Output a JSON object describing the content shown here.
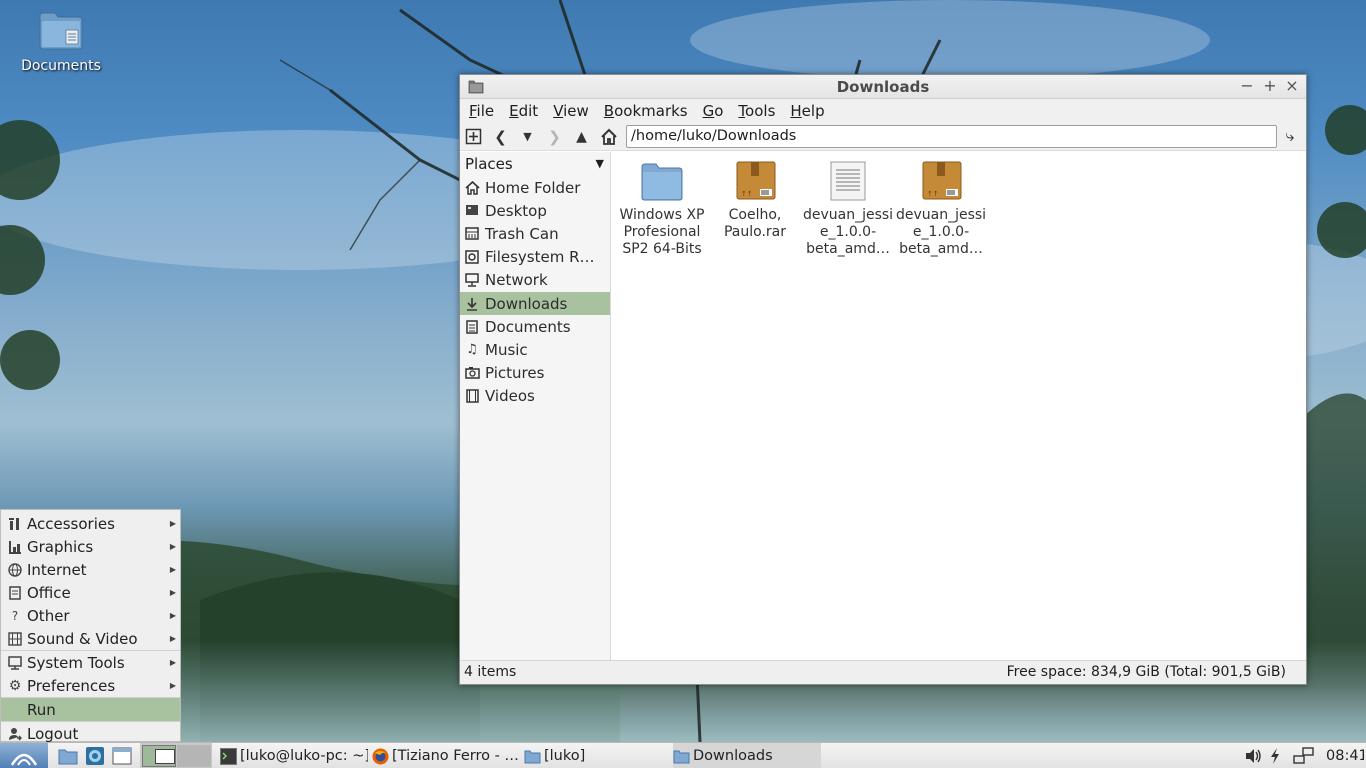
{
  "desktop": {
    "icons": [
      {
        "label": "Documents",
        "icon": "folder-icon"
      }
    ]
  },
  "window": {
    "title": "Downloads",
    "controls": {
      "minimize": "−",
      "maximize": "+",
      "close": "×"
    },
    "menu": [
      {
        "label": "File",
        "u": "F",
        "rest": "ile"
      },
      {
        "label": "Edit",
        "u": "E",
        "rest": "dit"
      },
      {
        "label": "View",
        "u": "V",
        "rest": "iew"
      },
      {
        "label": "Bookmarks",
        "u": "B",
        "rest": "ookmarks"
      },
      {
        "label": "Go",
        "u": "G",
        "rest": "o"
      },
      {
        "label": "Tools",
        "u": "T",
        "rest": "ools"
      },
      {
        "label": "Help",
        "u": "H",
        "rest": "elp"
      }
    ],
    "path": "/home/luko/Downloads",
    "sidebar": {
      "header": "Places",
      "items": [
        {
          "label": "Home Folder",
          "icon": "home-icon"
        },
        {
          "label": "Desktop",
          "icon": "desktop-icon"
        },
        {
          "label": "Trash Can",
          "icon": "trash-icon"
        },
        {
          "label": "Filesystem R…",
          "icon": "drive-icon"
        },
        {
          "label": "Network",
          "icon": "network-icon"
        },
        {
          "label": "Downloads",
          "icon": "download-icon",
          "active": true
        },
        {
          "label": "Documents",
          "icon": "document-icon"
        },
        {
          "label": "Music",
          "icon": "music-icon"
        },
        {
          "label": "Pictures",
          "icon": "camera-icon"
        },
        {
          "label": "Videos",
          "icon": "film-icon"
        }
      ]
    },
    "files": [
      {
        "line1": "Windows XP",
        "line2": "Profesional",
        "line3": "SP2 64-Bits",
        "icon": "folder-icon"
      },
      {
        "line1": "Coelho,",
        "line2": "Paulo.rar",
        "line3": "",
        "icon": "archive-icon"
      },
      {
        "line1": "devuan_jessi",
        "line2": "e_1.0.0-",
        "line3": "beta_amd…",
        "icon": "text-file-icon"
      },
      {
        "line1": "devuan_jessi",
        "line2": "e_1.0.0-",
        "line3": "beta_amd…",
        "icon": "archive-icon"
      }
    ],
    "status": {
      "items": "4 items",
      "space": "Free space: 834,9 GiB (Total: 901,5 GiB)"
    }
  },
  "start_menu": {
    "items": [
      {
        "label": "Accessories",
        "icon": "accessories-icon",
        "submenu": true
      },
      {
        "label": "Graphics",
        "icon": "graphics-icon",
        "submenu": true
      },
      {
        "label": "Internet",
        "icon": "globe-icon",
        "submenu": true
      },
      {
        "label": "Office",
        "icon": "office-icon",
        "submenu": true
      },
      {
        "label": "Other",
        "icon": "question-icon",
        "glyph": "?",
        "submenu": true
      },
      {
        "label": "Sound & Video",
        "icon": "media-icon",
        "submenu": true
      },
      {
        "label": "System Tools",
        "icon": "monitor-icon",
        "submenu": true
      },
      {
        "label": "Preferences",
        "icon": "gear-icon",
        "submenu": true
      },
      {
        "label": "Run",
        "icon": "",
        "submenu": false
      },
      {
        "label": "Logout",
        "icon": "logout-icon",
        "submenu": false
      }
    ]
  },
  "taskbar": {
    "tasks": [
      {
        "label": "[luko@luko-pc: ~]",
        "icon": "terminal-icon"
      },
      {
        "label": "[Tiziano Ferro - …",
        "icon": "firefox-icon"
      },
      {
        "label": "[luko]",
        "icon": "folder-icon"
      },
      {
        "label": "Downloads",
        "icon": "folder-icon"
      }
    ],
    "clock": "08:41"
  }
}
